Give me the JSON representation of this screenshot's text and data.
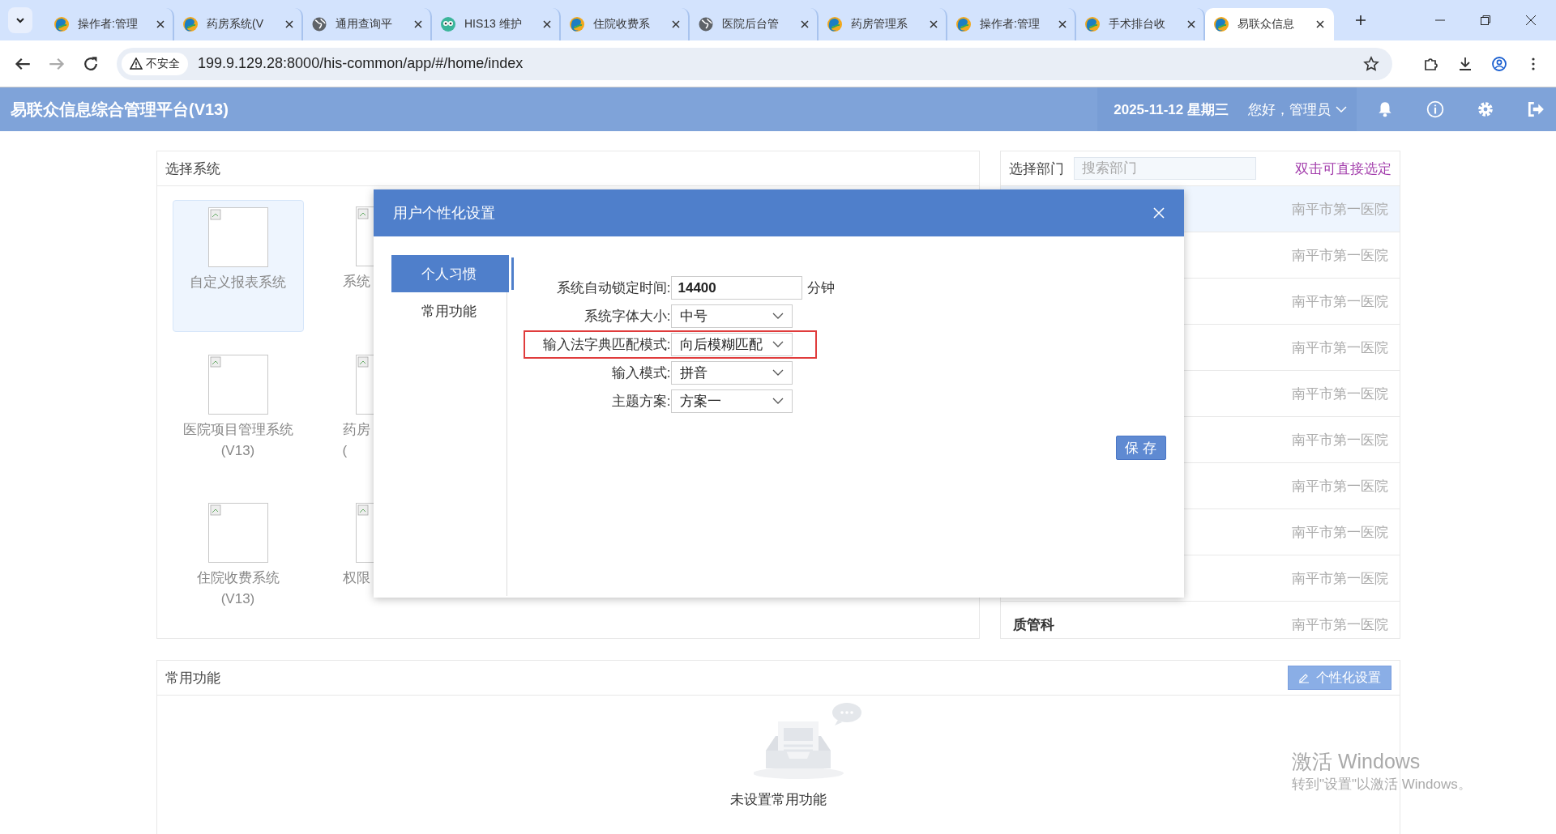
{
  "browser": {
    "tabs": [
      {
        "title": "操作者:管理",
        "kind": "logo",
        "selected": false
      },
      {
        "title": "药房系统(V",
        "kind": "logo",
        "selected": false
      },
      {
        "title": "通用查询平",
        "kind": "globe",
        "selected": false
      },
      {
        "title": "HIS13 维护",
        "kind": "owl",
        "selected": false
      },
      {
        "title": "住院收费系",
        "kind": "logo",
        "selected": false
      },
      {
        "title": "医院后台管",
        "kind": "globe",
        "selected": false
      },
      {
        "title": "药房管理系",
        "kind": "logo",
        "selected": false
      },
      {
        "title": "操作者:管理",
        "kind": "logo",
        "selected": false
      },
      {
        "title": "手术排台收",
        "kind": "logo",
        "selected": false
      },
      {
        "title": "易联众信息",
        "kind": "logo",
        "selected": true
      }
    ],
    "security": "不安全",
    "url": "199.9.129.28:8000/his-common/app/#/home/index"
  },
  "header": {
    "title": "易联众信息综合管理平台(V13)",
    "date": "2025-11-12 星期三",
    "user": "您好，管理员"
  },
  "systems": {
    "title": "选择系统",
    "items": [
      {
        "label": "自定义报表系统",
        "selected": true
      },
      {
        "label": "系统",
        "selected": false
      },
      {
        "label": "医院项目管理系统(V13)",
        "selected": false
      },
      {
        "label": "药房\n(",
        "selected": false
      },
      {
        "label": "住院收费系统(V13)",
        "selected": false
      },
      {
        "label": "权限",
        "selected": false
      }
    ]
  },
  "departments": {
    "title": "选择部门",
    "search_placeholder": "搜索部门",
    "hint": "双击可直接选定",
    "rows": [
      {
        "hospital": "南平市第一医院",
        "selected": true
      },
      {
        "hospital": "南平市第一医院",
        "selected": false
      },
      {
        "hospital": "南平市第一医院",
        "selected": false
      },
      {
        "hospital": "南平市第一医院",
        "selected": false
      },
      {
        "hospital": "南平市第一医院",
        "selected": false
      },
      {
        "hospital": "南平市第一医院",
        "selected": false
      },
      {
        "hospital": "南平市第一医院",
        "selected": false
      },
      {
        "hospital": "南平市第一医院",
        "selected": false
      },
      {
        "hospital": "南平市第一医院",
        "selected": false
      },
      {
        "name": "质管科",
        "hospital": "南平市第一医院",
        "selected": false
      }
    ]
  },
  "favorites": {
    "title": "常用功能",
    "button": "个性化设置",
    "empty": "未设置常用功能"
  },
  "dialog": {
    "title": "用户个性化设置",
    "nav": [
      {
        "label": "个人习惯",
        "selected": true
      },
      {
        "label": "常用功能",
        "selected": false
      }
    ],
    "fields": [
      {
        "label": "系统自动锁定时间:",
        "kind": "input",
        "value": "14400",
        "suffix": "分钟",
        "highlighted": false
      },
      {
        "label": "系统字体大小:",
        "kind": "select",
        "value": "中号",
        "highlighted": false
      },
      {
        "label": "输入法字典匹配模式:",
        "kind": "select",
        "value": "向后模糊匹配",
        "highlighted": true
      },
      {
        "label": "输入模式:",
        "kind": "select",
        "value": "拼音",
        "highlighted": false
      },
      {
        "label": "主题方案:",
        "kind": "select",
        "value": "方案一",
        "highlighted": false
      }
    ],
    "save": "保 存"
  },
  "os_notice": {
    "title": "激活 Windows",
    "text": "转到\"设置\"以激活 Windows。"
  }
}
